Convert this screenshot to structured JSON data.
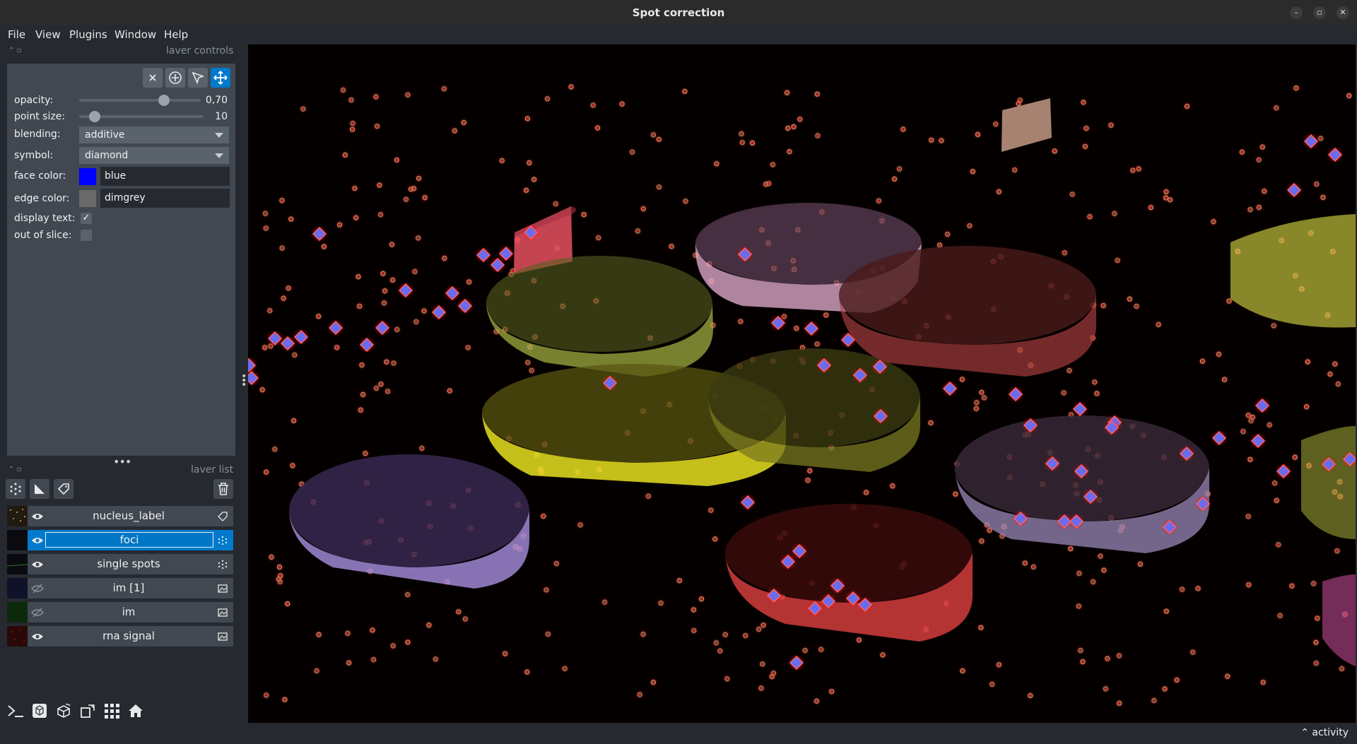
{
  "window": {
    "title": "Spot correction",
    "controls": [
      "minimize-icon",
      "maximize-icon",
      "close-icon"
    ]
  },
  "menu": {
    "items": [
      "File",
      "View",
      "Plugins",
      "Window",
      "Help"
    ]
  },
  "layer_controls": {
    "dock_title": "laver controls",
    "tools": [
      "delete-selected-icon",
      "add-points-icon",
      "select-points-icon",
      "pan-zoom-icon"
    ],
    "active_tool": "pan-zoom-icon",
    "opacity": {
      "label": "opacity:",
      "value": 0.7,
      "display": "0,70"
    },
    "point_size": {
      "label": "point size:",
      "value": 10,
      "min": 1,
      "max": 100,
      "display": "10"
    },
    "blending": {
      "label": "blending:",
      "value": "additive"
    },
    "symbol": {
      "label": "symbol:",
      "value": "diamond"
    },
    "face_color": {
      "label": "face color:",
      "value": "blue",
      "swatch": "#0000ff"
    },
    "edge_color": {
      "label": "edge color:",
      "value": "dimgrey",
      "swatch": "#696969"
    },
    "display_text": {
      "label": "display text:",
      "checked": true,
      "mark": "✓"
    },
    "out_of_slice": {
      "label": "out of slice:",
      "checked": false
    }
  },
  "layer_list": {
    "dock_title": "laver list",
    "buttons": [
      "new-points-layer-icon",
      "new-shapes-layer-icon",
      "new-labels-layer-icon",
      "delete-layer-icon"
    ],
    "layers": [
      {
        "name": "nucleus_label",
        "visible": true,
        "type": "labels",
        "selected": false
      },
      {
        "name": "foci",
        "visible": true,
        "type": "points",
        "selected": true
      },
      {
        "name": "single spots",
        "visible": true,
        "type": "points",
        "selected": false
      },
      {
        "name": "im [1]",
        "visible": false,
        "type": "image",
        "selected": false
      },
      {
        "name": "im",
        "visible": false,
        "type": "image",
        "selected": false
      },
      {
        "name": "rna signal",
        "visible": true,
        "type": "image",
        "selected": false
      }
    ]
  },
  "viewer_buttons": [
    "console-icon",
    "ndisplay-3d-icon",
    "roll-dims-icon",
    "transpose-icon",
    "grid-icon",
    "home-icon"
  ],
  "status": {
    "activity": "activity"
  },
  "colors": {
    "panel": "#414851",
    "background": "#262930",
    "accent": "#007acc",
    "canvas": "#000000"
  }
}
